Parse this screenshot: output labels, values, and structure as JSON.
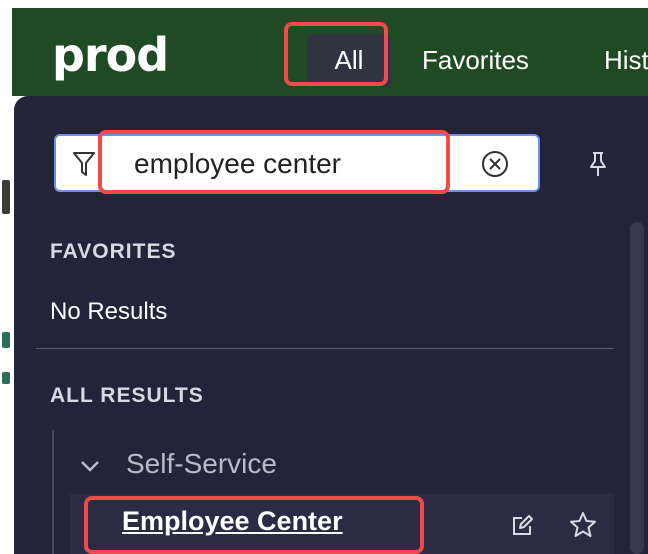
{
  "app": {
    "logo": "prod"
  },
  "nav": {
    "tabs": [
      {
        "label": "All"
      },
      {
        "label": "Favorites"
      },
      {
        "label": "Hist"
      }
    ]
  },
  "filter": {
    "search_value": "employee center"
  },
  "sections": {
    "favorites_title": "FAVORITES",
    "favorites_empty": "No Results",
    "all_results_title": "ALL RESULTS"
  },
  "results": {
    "group_label": "Self-Service",
    "item_label": "Employee Center"
  },
  "colors": {
    "topbar": "#1f4a24",
    "panel": "#23233a",
    "highlight": "#ef4b4b",
    "search_border": "#6f8ff0"
  },
  "icons": [
    "filter-icon",
    "clear-icon",
    "pin-icon",
    "chevron-down-icon",
    "edit-icon",
    "star-icon"
  ]
}
